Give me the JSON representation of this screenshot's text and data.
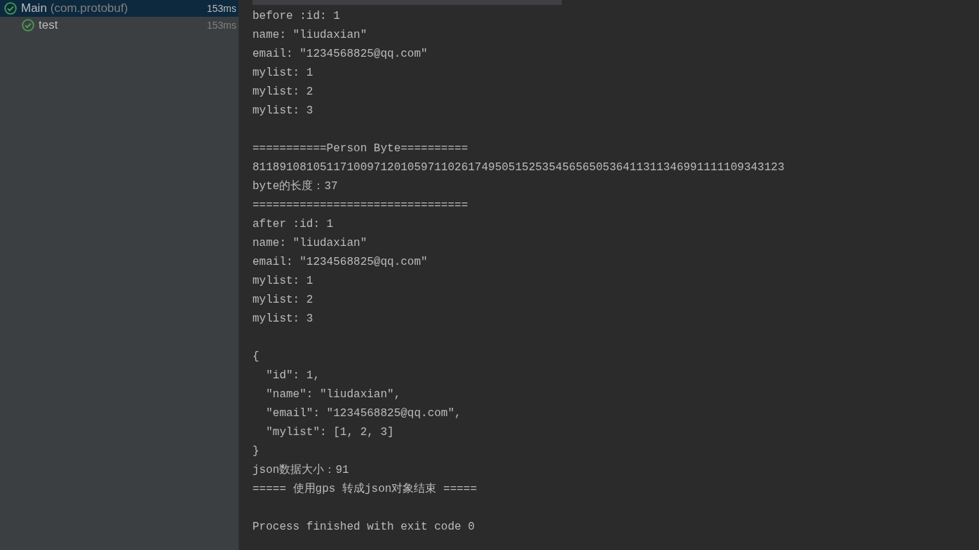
{
  "test_tree": [
    {
      "label": "Main",
      "detail": "(com.protobuf)",
      "time": "153ms",
      "passed": true,
      "selected": true,
      "children": [
        {
          "label": "test",
          "time": "153ms",
          "passed": true,
          "selected": false
        }
      ]
    }
  ],
  "console": {
    "blocks": [
      [
        "before :id: 1",
        "name: \"liudaxian\"",
        "email: \"1234568825@qq.com\"",
        "mylist: 1",
        "mylist: 2",
        "mylist: 3"
      ],
      [
        "===========Person Byte==========",
        "8118910810511710097120105971102617495051525354565650536411311346991111109343123",
        "byte的长度：37",
        "================================",
        "after :id: 1",
        "name: \"liudaxian\"",
        "email: \"1234568825@qq.com\"",
        "mylist: 1",
        "mylist: 2",
        "mylist: 3"
      ],
      [
        "{",
        "  \"id\": 1,",
        "  \"name\": \"liudaxian\",",
        "  \"email\": \"1234568825@qq.com\",",
        "  \"mylist\": [1, 2, 3]",
        "}",
        "json数据大小：91",
        "===== 使用gps 转成json对象结束 ====="
      ],
      [
        "Process finished with exit code 0"
      ]
    ]
  }
}
